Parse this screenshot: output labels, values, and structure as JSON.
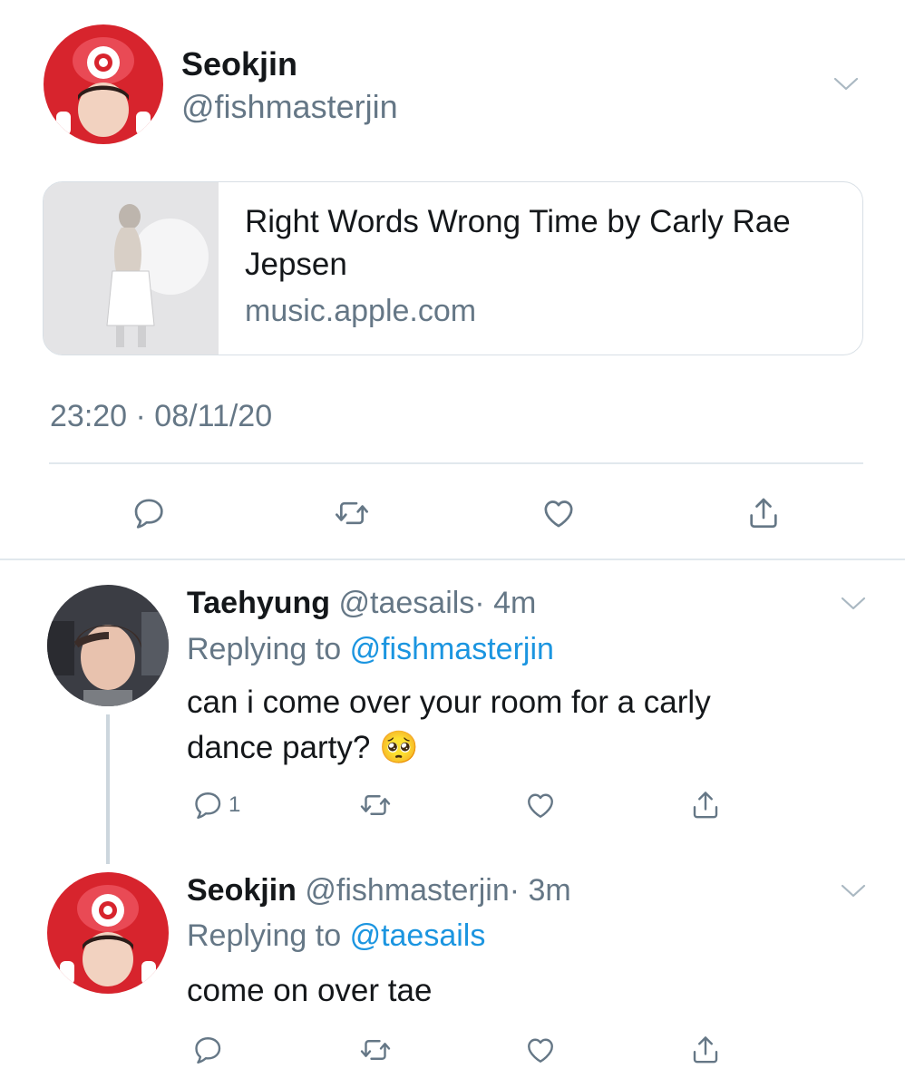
{
  "main_tweet": {
    "author_name": "Seokjin",
    "author_handle": "@fishmasterjin",
    "card": {
      "title": "Right Words Wrong Time by Carly Rae Jepsen",
      "domain": "music.apple.com"
    },
    "timestamp": "23:20 · 08/11/20"
  },
  "replies": [
    {
      "name": "Taehyung",
      "handle": "@taesails",
      "time": "· 4m",
      "replying_label": "Replying to",
      "replying_to": "@fishmasterjin",
      "text": "can i come over your room for a carly dance party? 🥺",
      "reply_count": "1"
    },
    {
      "name": "Seokjin",
      "handle": "@fishmasterjin",
      "time": "· 3m",
      "replying_label": "Replying to",
      "replying_to": "@taesails",
      "text": "come on over tae",
      "reply_count": ""
    }
  ],
  "colors": {
    "text": "#14171a",
    "secondary": "#657786",
    "link": "#1b95e0",
    "divider": "#e1e8ed"
  },
  "icons": [
    "avatar",
    "chevron-down-icon",
    "reply-icon",
    "retweet-icon",
    "like-icon",
    "share-icon"
  ]
}
